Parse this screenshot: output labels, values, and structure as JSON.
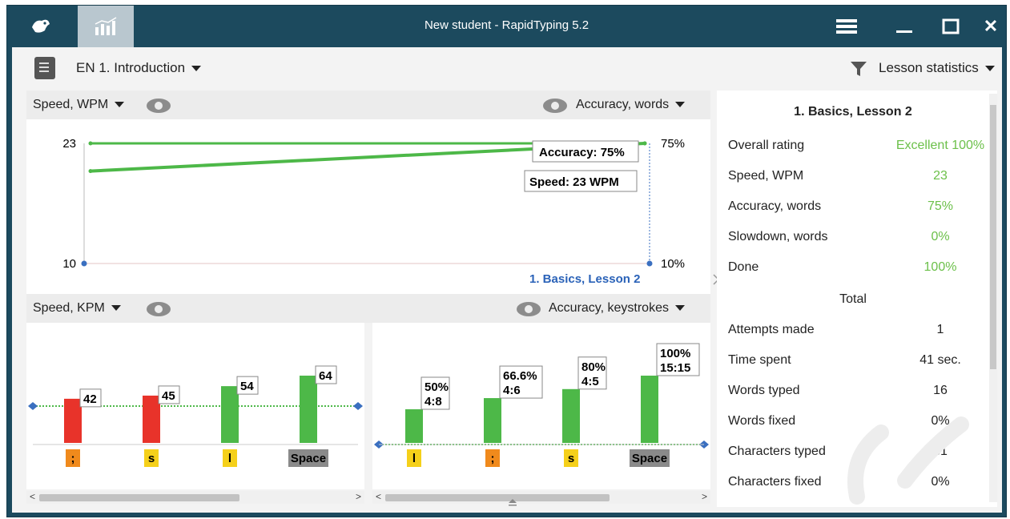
{
  "window": {
    "title": "New student - RapidTyping 5.2",
    "close_glyph": "✕",
    "menu_icon": "hamburger-menu-icon"
  },
  "toolbar": {
    "lesson_select": "EN 1. Introduction",
    "stats_select": "Lesson statistics"
  },
  "speed_section": {
    "left_dropdown": "Speed, WPM",
    "right_dropdown": "Accuracy, words",
    "y_left_max": "23",
    "y_left_min": "10",
    "y_right_max": "75%",
    "y_right_min": "10%",
    "tooltip_accuracy": "Accuracy: 75%",
    "tooltip_speed": "Speed: 23 WPM",
    "lesson_label": "1. Basics, Lesson 2"
  },
  "kpm_section": {
    "left_dropdown": "Speed, KPM",
    "right_dropdown": "Accuracy, keystrokes"
  },
  "chart_data": [
    {
      "type": "line",
      "ylabel": "Speed, WPM",
      "y2label": "Accuracy, words",
      "series": [
        {
          "name": "Speed, WPM",
          "values": [
            23,
            23
          ]
        },
        {
          "name": "Accuracy, words",
          "values": [
            60,
            75
          ]
        }
      ],
      "ylim": [
        10,
        23
      ],
      "y2lim": [
        10,
        75
      ],
      "categories": [
        "",
        "1. Basics, Lesson 2"
      ]
    },
    {
      "type": "bar",
      "ylabel": "Speed, KPM",
      "categories": [
        ";",
        "s",
        "l",
        "Space"
      ],
      "values": [
        42,
        45,
        54,
        64
      ],
      "colors": [
        "#e8332a",
        "#e8332a",
        "#4db848",
        "#4db848"
      ],
      "key_colors": [
        "#f08a1c",
        "#f5d01a",
        "#f5d01a",
        "#8a8a8a"
      ],
      "reference": 48
    },
    {
      "type": "bar",
      "ylabel": "Accuracy, keystrokes",
      "categories": [
        "l",
        ";",
        "s",
        "Space"
      ],
      "values": [
        50,
        66.6,
        80,
        100
      ],
      "labels": [
        [
          "50%",
          "4:8"
        ],
        [
          "66.6%",
          "4:6"
        ],
        [
          "80%",
          "4:5"
        ],
        [
          "100%",
          "15:15"
        ]
      ],
      "colors": [
        "#4db848",
        "#4db848",
        "#4db848",
        "#4db848"
      ],
      "key_colors": [
        "#f5d01a",
        "#f08a1c",
        "#f5d01a",
        "#8a8a8a"
      ]
    }
  ],
  "stats": {
    "title": "1. Basics, Lesson 2",
    "rows": [
      {
        "label": "Overall rating",
        "value": "Excellent 100%",
        "green": true
      },
      {
        "label": "Speed, WPM",
        "value": "23",
        "green": true
      },
      {
        "label": "Accuracy, words",
        "value": "75%",
        "green": true
      },
      {
        "label": "Slowdown, words",
        "value": "0%",
        "green": true
      },
      {
        "label": "Done",
        "value": "100%",
        "green": true
      }
    ],
    "total_label": "Total",
    "total_rows": [
      {
        "label": "Attempts made",
        "value": "1"
      },
      {
        "label": "Time spent",
        "value": "41 sec."
      },
      {
        "label": "Words typed",
        "value": "16"
      },
      {
        "label": "Words fixed",
        "value": "0%"
      },
      {
        "label": "Characters typed",
        "value": "31"
      },
      {
        "label": "Characters fixed",
        "value": "0%"
      }
    ]
  },
  "colors": {
    "titlebar": "#1c4a5e",
    "green": "#4db848",
    "red": "#e8332a",
    "blue_label": "#2a62b8"
  }
}
